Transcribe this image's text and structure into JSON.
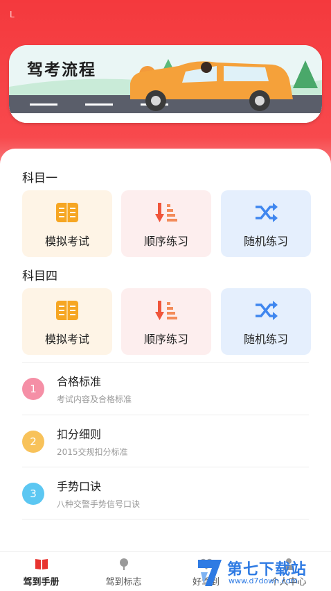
{
  "status": {
    "left_glyph": "L"
  },
  "banner": {
    "title": "驾考流程"
  },
  "subject1": {
    "title": "科目一",
    "tiles": [
      {
        "label": "模拟考试",
        "icon": "book-icon"
      },
      {
        "label": "顺序练习",
        "icon": "sort-icon"
      },
      {
        "label": "随机练习",
        "icon": "shuffle-icon"
      }
    ]
  },
  "subject4": {
    "title": "科目四",
    "tiles": [
      {
        "label": "模拟考试",
        "icon": "book-icon"
      },
      {
        "label": "顺序练习",
        "icon": "sort-icon"
      },
      {
        "label": "随机练习",
        "icon": "shuffle-icon"
      }
    ]
  },
  "guide_list": [
    {
      "num": "1",
      "title": "合格标准",
      "subtitle": "考试内容及合格标准",
      "color": "#f58fa6"
    },
    {
      "num": "2",
      "title": "扣分细则",
      "subtitle": "2015交规扣分标准",
      "color": "#f8c25a"
    },
    {
      "num": "3",
      "title": "手势口诀",
      "subtitle": "八种交警手势信号口诀",
      "color": "#5cc7f2"
    }
  ],
  "tabbar": {
    "items": [
      {
        "label": "驾到手册",
        "icon": "handbook-icon",
        "active": true
      },
      {
        "label": "驾到标志",
        "icon": "sign-icon",
        "active": false
      },
      {
        "label": "好驾到",
        "icon": "heart-icon",
        "active": false
      },
      {
        "label": "个人中心",
        "icon": "person-icon",
        "active": false
      }
    ]
  },
  "watermark": {
    "text": "第七下载站",
    "url": "www.d7down.com"
  },
  "colors": {
    "brand_red": "#f4393d",
    "orange": "#f5a623",
    "blue": "#2f7be3"
  }
}
